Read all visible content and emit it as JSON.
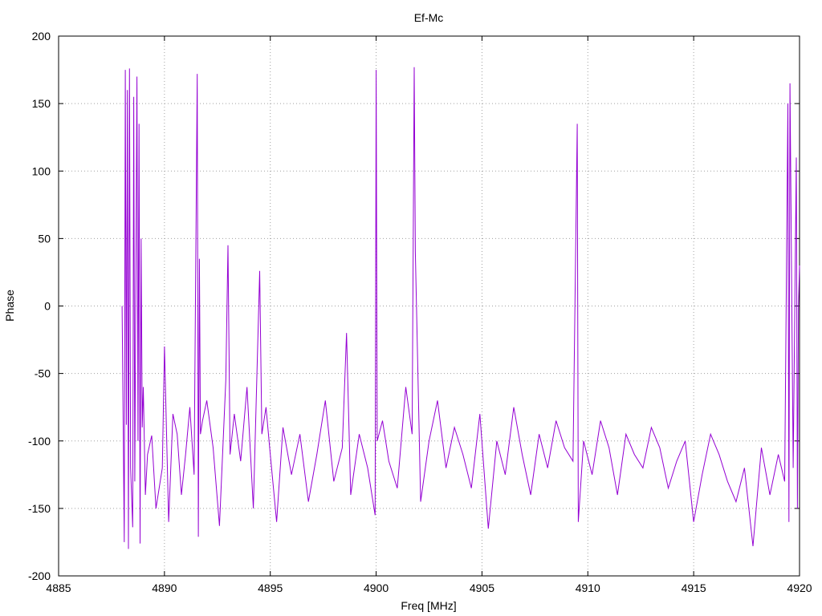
{
  "chart_data": {
    "type": "line",
    "title": "Ef-Mc",
    "xlabel": "Freq [MHz]",
    "ylabel": "Phase",
    "xlim": [
      4885,
      4920
    ],
    "ylim": [
      -200,
      200
    ],
    "xticks": [
      4885,
      4890,
      4895,
      4900,
      4905,
      4910,
      4915,
      4920
    ],
    "yticks": [
      -200,
      -150,
      -100,
      -50,
      0,
      50,
      100,
      150,
      200
    ],
    "xtick_labels": [
      "4885",
      "4890",
      "4895",
      "4900",
      "4905",
      "4910",
      "4915",
      "4920"
    ],
    "ytick_labels": [
      "-200",
      "-150",
      "-100",
      "-50",
      "0",
      "50",
      "100",
      "150",
      "200"
    ],
    "grid": true,
    "line_color": "#9400d3",
    "series": [
      {
        "x": [
          4888.0,
          4888.1,
          4888.15,
          4888.2,
          4888.25,
          4888.3,
          4888.35,
          4888.4,
          4888.5,
          4888.55,
          4888.6,
          4888.7,
          4888.75,
          4888.8,
          4888.85,
          4888.9,
          4888.95,
          4889.0,
          4889.1,
          4889.2,
          4889.4,
          4889.6,
          4889.9,
          4890.0,
          4890.2,
          4890.4,
          4890.6,
          4890.8,
          4891.0,
          4891.2,
          4891.4,
          4891.55,
          4891.6,
          4891.65,
          4891.7,
          4891.8,
          4892.0,
          4892.3,
          4892.6,
          4892.9,
          4893.0,
          4893.1,
          4893.3,
          4893.6,
          4893.9,
          4894.2,
          4894.5,
          4894.6,
          4894.8,
          4895.0,
          4895.3,
          4895.6,
          4896.0,
          4896.4,
          4896.8,
          4897.2,
          4897.6,
          4898.0,
          4898.4,
          4898.6,
          4898.8,
          4899.2,
          4899.6,
          4899.95,
          4900.0,
          4900.05,
          4900.3,
          4900.6,
          4901.0,
          4901.4,
          4901.7,
          4901.8,
          4901.85,
          4902.1,
          4902.5,
          4902.9,
          4903.3,
          4903.7,
          4904.1,
          4904.5,
          4904.9,
          4905.3,
          4905.7,
          4906.1,
          4906.5,
          4906.9,
          4907.3,
          4907.7,
          4908.1,
          4908.5,
          4908.9,
          4909.3,
          4909.5,
          4909.55,
          4909.8,
          4910.2,
          4910.6,
          4911.0,
          4911.4,
          4911.8,
          4912.2,
          4912.6,
          4913.0,
          4913.4,
          4913.8,
          4914.2,
          4914.6,
          4915.0,
          4915.4,
          4915.8,
          4916.2,
          4916.6,
          4917.0,
          4917.4,
          4917.8,
          4918.2,
          4918.6,
          4919.0,
          4919.3,
          4919.45,
          4919.5,
          4919.55,
          4919.7,
          4919.85,
          4919.9,
          4919.95,
          4920.0
        ],
        "y": [
          0,
          -175,
          175,
          -88,
          160,
          -180,
          176,
          -120,
          -164,
          155,
          -130,
          170,
          -100,
          135,
          -176,
          50,
          -90,
          -60,
          -140,
          -110,
          -96,
          -150,
          -120,
          -30,
          -160,
          -80,
          -95,
          -140,
          -110,
          -75,
          -125,
          172,
          -171,
          35,
          -95,
          -85,
          -70,
          -105,
          -163,
          -55,
          45,
          -110,
          -80,
          -115,
          -60,
          -150,
          26,
          -95,
          -75,
          -110,
          -160,
          -90,
          -125,
          -95,
          -145,
          -110,
          -70,
          -130,
          -105,
          -20,
          -140,
          -95,
          -120,
          -155,
          175,
          -100,
          -85,
          -115,
          -135,
          -60,
          -95,
          177,
          40,
          -145,
          -100,
          -70,
          -120,
          -90,
          -110,
          -135,
          -80,
          -165,
          -100,
          -125,
          -75,
          -110,
          -140,
          -95,
          -120,
          -85,
          -105,
          -115,
          135,
          -160,
          -100,
          -125,
          -85,
          -105,
          -140,
          -95,
          -110,
          -120,
          -90,
          -105,
          -135,
          -115,
          -100,
          -160,
          -125,
          -95,
          -110,
          -130,
          -145,
          -120,
          -178,
          -105,
          -140,
          -110,
          -130,
          150,
          -160,
          165,
          -120,
          110,
          -150,
          0,
          30
        ]
      }
    ]
  }
}
